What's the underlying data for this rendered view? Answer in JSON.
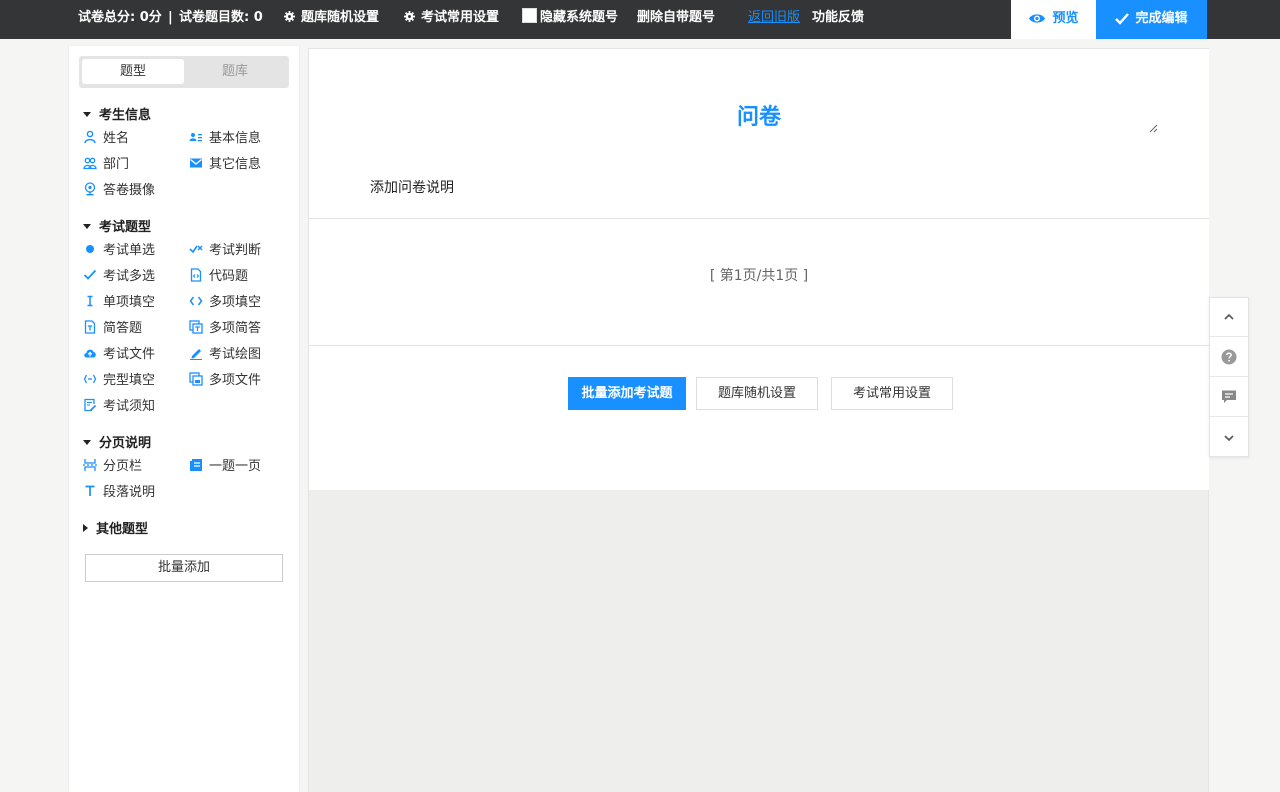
{
  "topbar": {
    "total_score": "试卷总分: 0分",
    "separator": "|",
    "question_count": "试卷题目数: 0",
    "random_settings": "题库随机设置",
    "common_settings": "考试常用设置",
    "hide_numbers": "隐藏系统题号",
    "delete_numbers": "删除自带题号",
    "back_old": "返回旧版",
    "feedback": "功能反馈",
    "preview": "预览",
    "done": "完成编辑"
  },
  "sidebar": {
    "tabs": [
      "题型",
      "题库"
    ],
    "groups": [
      {
        "title": "考生信息",
        "items": [
          "姓名",
          "基本信息",
          "部门",
          "其它信息",
          "答卷摄像"
        ]
      },
      {
        "title": "考试题型",
        "items": [
          "考试单选",
          "考试判断",
          "考试多选",
          "代码题",
          "单项填空",
          "多项填空",
          "简答题",
          "多项简答",
          "考试文件",
          "考试绘图",
          "完型填空",
          "多项文件",
          "考试须知"
        ]
      },
      {
        "title": "分页说明",
        "items": [
          "分页栏",
          "一题一页",
          "段落说明"
        ]
      },
      {
        "title": "其他题型",
        "items": []
      }
    ],
    "batch_add": "批量添加"
  },
  "main": {
    "title": "问卷",
    "description": "添加问卷说明",
    "pager": "[ 第1页/共1页 ]",
    "actions": [
      "批量添加考试题",
      "题库随机设置",
      "考试常用设置"
    ]
  },
  "colors": {
    "accent": "#1890ff",
    "topbar": "#333536"
  }
}
